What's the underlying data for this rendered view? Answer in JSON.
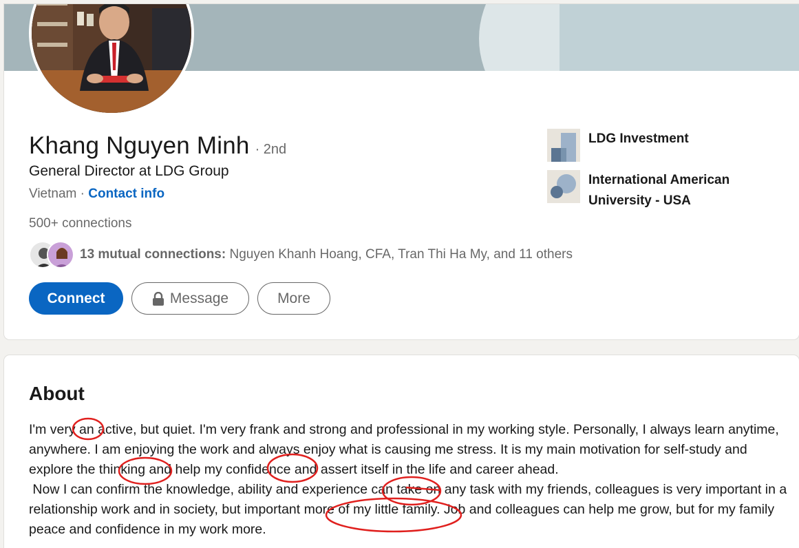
{
  "profile": {
    "name": "Khang Nguyen Minh",
    "degree": "· 2nd",
    "headline": "General Director at LDG Group",
    "location": "Vietnam",
    "separator": " · ",
    "contact_info": "Contact info",
    "connections": "500+ connections",
    "mutual_bold": "13 mutual connections:",
    "mutual_names": " Nguyen Khanh Hoang, CFA, Tran Thi Ha My, and 11 others"
  },
  "actions": {
    "connect": "Connect",
    "message": "Message",
    "more": "More"
  },
  "experience": [
    {
      "label": "LDG Investment",
      "icon": "company-logo-icon"
    },
    {
      "label": "International American University - USA",
      "icon": "school-logo-icon"
    }
  ],
  "about": {
    "title": "About",
    "body": "I'm very an active, but quiet. I'm very frank and strong and professional in my working style. Personally, I always learn anytime, anywhere. I am enjoying the work and always enjoy what is causing me stress. It is my main motivation for self-study and explore the thinking and help my confidence and assert itself in the life and career ahead.\n Now I can confirm the knowledge, ability and experience can take on any task with my friends, colleagues is very important in a relationship work and in society, but important more of my little family. Job and colleagues can help me grow, but for my family peace and confidence in my work more."
  },
  "colors": {
    "primary": "#0a66c2",
    "annotation": "#e0201e",
    "banner": "#a4b5ba"
  }
}
